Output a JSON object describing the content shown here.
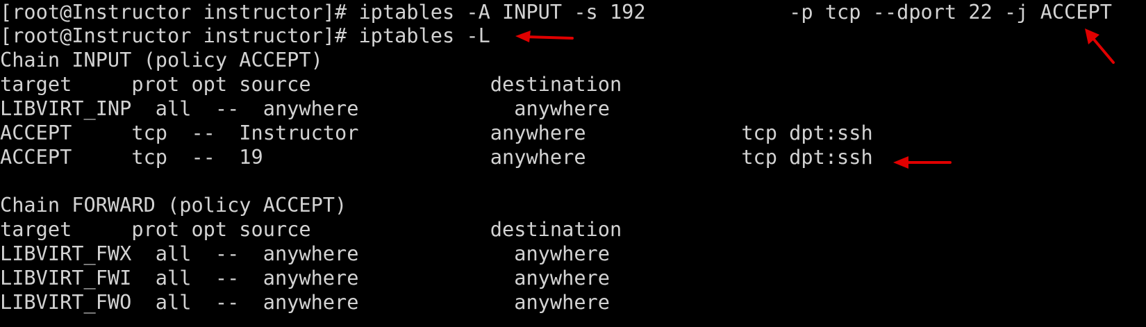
{
  "terminal": {
    "lines": [
      "[root@Instructor instructor]# iptables -A INPUT -s 192            -p tcp --dport 22 -j ACCEPT",
      "[root@Instructor instructor]# iptables -L",
      "Chain INPUT (policy ACCEPT)",
      "target     prot opt source               destination",
      "LIBVIRT_INP  all  --  anywhere             anywhere",
      "ACCEPT     tcp  --  Instructor           anywhere             tcp dpt:ssh",
      "ACCEPT     tcp  --  19                   anywhere             tcp dpt:ssh",
      "",
      "Chain FORWARD (policy ACCEPT)",
      "target     prot opt source               destination",
      "LIBVIRT_FWX  all  --  anywhere             anywhere",
      "LIBVIRT_FWI  all  --  anywhere             anywhere",
      "LIBVIRT_FWO  all  --  anywhere             anywhere"
    ]
  },
  "colors": {
    "background": "#000000",
    "text": "#d3d3d3",
    "annotation_arrow": "#e00000"
  },
  "annotations": {
    "arrow_icon": "red-arrow"
  }
}
